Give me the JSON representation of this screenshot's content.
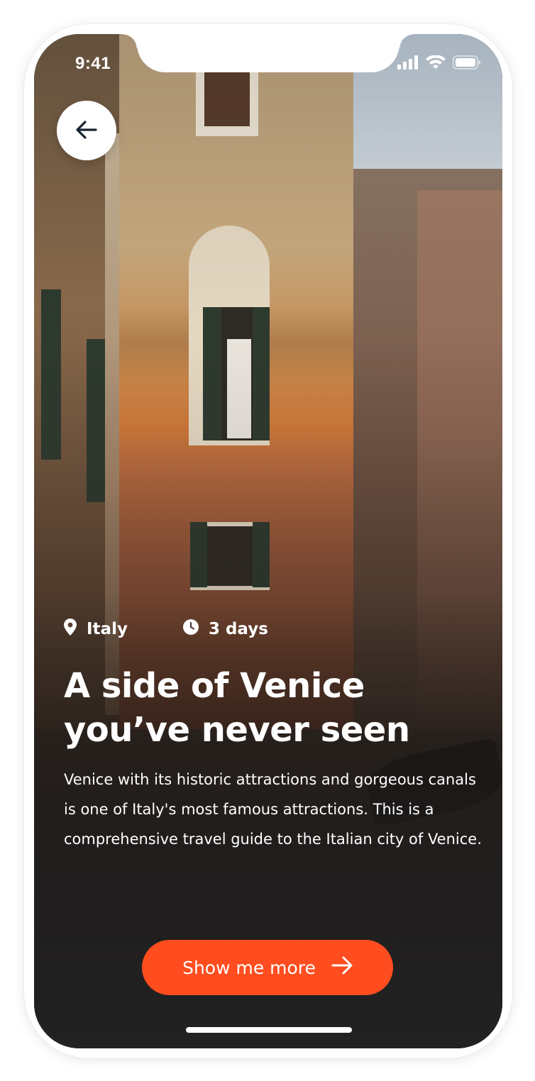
{
  "status_bar": {
    "time": "9:41"
  },
  "navigation": {
    "back_icon": "arrow-left-icon"
  },
  "destination": {
    "location": "Italy",
    "location_icon": "map-pin-icon",
    "duration": "3 days",
    "duration_icon": "clock-icon",
    "title": "A side of Venice you’ve never seen",
    "description": "Venice with its historic attractions and gorgeous canals is one of Italy's most famous attractions. This is a comprehensive travel guide to the Italian city of Venice."
  },
  "cta": {
    "label": "Show me more",
    "icon": "arrow-right-icon"
  },
  "colors": {
    "accent": "#ff4d1f",
    "text_on_image": "#ffffff"
  }
}
